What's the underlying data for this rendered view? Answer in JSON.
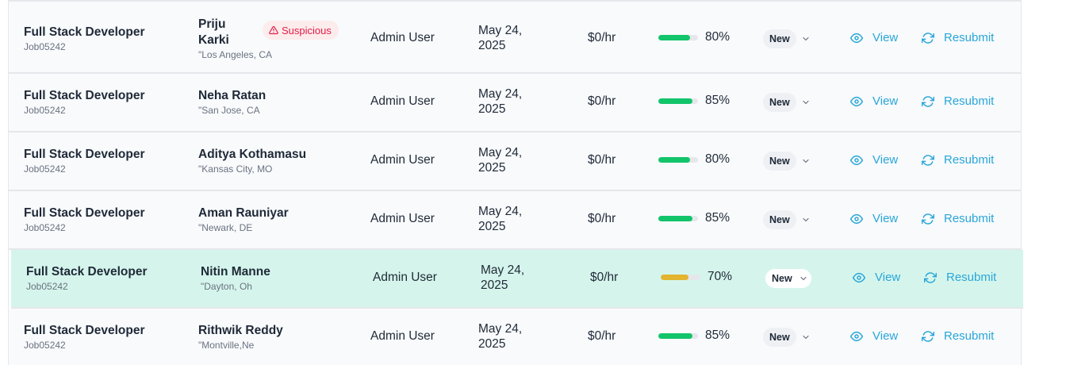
{
  "rows": [
    {
      "job_title": "Full Stack Developer",
      "job_id": "Job05242",
      "candidate": "Priju Karki",
      "candidate_line1": "Priju",
      "candidate_line2": "Karki",
      "location": "\"Los Angeles, CA",
      "badge": "Suspicious",
      "added_by": "Admin User",
      "date_line1": "May 24,",
      "date_line2": "2025",
      "rate": "$0/hr",
      "score": 80,
      "score_label": "80%",
      "score_color": "#12c46a",
      "status": "New",
      "view_label": "View",
      "resubmit_label": "Resubmit"
    },
    {
      "job_title": "Full Stack Developer",
      "job_id": "Job05242",
      "candidate": "Neha Ratan",
      "location": "\"San Jose, CA",
      "added_by": "Admin User",
      "date_line1": "May 24,",
      "date_line2": "2025",
      "rate": "$0/hr",
      "score": 85,
      "score_label": "85%",
      "score_color": "#12c46a",
      "status": "New",
      "view_label": "View",
      "resubmit_label": "Resubmit"
    },
    {
      "job_title": "Full Stack Developer",
      "job_id": "Job05242",
      "candidate": "Aditya Kothamasu",
      "location": "\"Kansas City, MO",
      "added_by": "Admin User",
      "date_line1": "May 24,",
      "date_line2": "2025",
      "rate": "$0/hr",
      "score": 80,
      "score_label": "80%",
      "score_color": "#12c46a",
      "status": "New",
      "view_label": "View",
      "resubmit_label": "Resubmit"
    },
    {
      "job_title": "Full Stack Developer",
      "job_id": "Job05242",
      "candidate": "Aman Rauniyar",
      "location": "\"Newark, DE",
      "added_by": "Admin User",
      "date_line1": "May 24,",
      "date_line2": "2025",
      "rate": "$0/hr",
      "score": 85,
      "score_label": "85%",
      "score_color": "#12c46a",
      "status": "New",
      "view_label": "View",
      "resubmit_label": "Resubmit"
    },
    {
      "job_title": "Full Stack Developer",
      "job_id": "Job05242",
      "candidate": "Nitin Manne",
      "location": "\"Dayton, Oh",
      "added_by": "Admin User",
      "date_line1": "May 24,",
      "date_line2": "2025",
      "rate": "$0/hr",
      "score": 70,
      "score_label": "70%",
      "score_color": "#e3b530",
      "status": "New",
      "view_label": "View",
      "resubmit_label": "Resubmit",
      "highlighted": true
    },
    {
      "job_title": "Full Stack Developer",
      "job_id": "Job05242",
      "candidate": "Rithwik Reddy",
      "location": "\"Montville,Ne",
      "added_by": "Admin User",
      "date_line1": "May 24,",
      "date_line2": "2025",
      "rate": "$0/hr",
      "score": 85,
      "score_label": "85%",
      "score_color": "#12c46a",
      "status": "New",
      "view_label": "View",
      "resubmit_label": "Resubmit"
    }
  ],
  "icons": {
    "view": "eye-icon",
    "resubmit": "refresh-icon",
    "status_toggle": "chevron-down-icon",
    "badge": "warning-triangle-icon"
  },
  "colors": {
    "accent": "#2aa6d8",
    "highlight_row": "#d5f5ec",
    "badge_text": "#e11d48",
    "badge_bg": "#fdecec"
  }
}
